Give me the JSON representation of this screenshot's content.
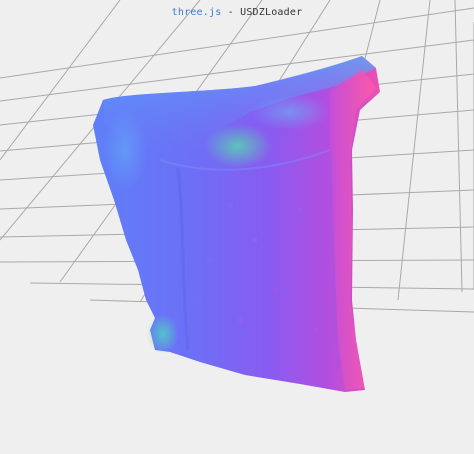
{
  "header": {
    "link_label": "three.js",
    "separator": " - ",
    "title": "USDZLoader"
  },
  "scene": {
    "background": "#efefef",
    "grid_color": "#a9a9a9",
    "model": {
      "name": "normal-shaded bag mesh",
      "colors": [
        "#6a7df6",
        "#7f63f2",
        "#a04fe6",
        "#f04fb6",
        "#5fb7f2",
        "#4de0b0"
      ]
    }
  }
}
